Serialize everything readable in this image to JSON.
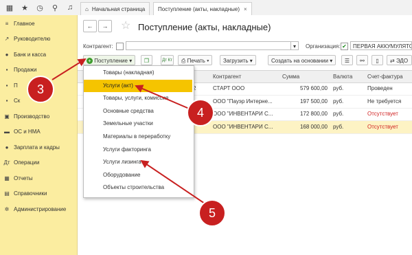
{
  "topbar": {
    "home_tab": "Начальная страница",
    "doc_tab": "Поступление (акты, накладные)",
    "tab_close": "×"
  },
  "sidebar": {
    "items": [
      {
        "label": "Главное",
        "icon": "menu-icon",
        "glyph": "≡"
      },
      {
        "label": "Руководителю",
        "icon": "chart-icon",
        "glyph": "↗"
      },
      {
        "label": "Банк и касса",
        "icon": "bank-icon",
        "glyph": "●"
      },
      {
        "label": "Продажи",
        "icon": "bag-icon",
        "glyph": "▪"
      },
      {
        "label": "П",
        "icon": "purchases-icon",
        "glyph": "▪"
      },
      {
        "label": "Ск",
        "icon": "warehouse-icon",
        "glyph": "▪"
      },
      {
        "label": "Производство",
        "icon": "production-icon",
        "glyph": "▣"
      },
      {
        "label": "ОС и НМА",
        "icon": "assets-icon",
        "glyph": "▬"
      },
      {
        "label": "Зарплата и кадры",
        "icon": "people-icon",
        "glyph": "●"
      },
      {
        "label": "Операции",
        "icon": "operations-icon",
        "glyph": "Дт"
      },
      {
        "label": "Отчеты",
        "icon": "reports-icon",
        "glyph": "▦"
      },
      {
        "label": "Справочники",
        "icon": "catalog-icon",
        "glyph": "▤"
      },
      {
        "label": "Администрирование",
        "icon": "gear-icon",
        "glyph": "✲"
      }
    ]
  },
  "header": {
    "title": "Поступление (акты, накладные)",
    "back": "←",
    "forward": "→",
    "star": "☆"
  },
  "filters": {
    "contractor_label": "Контрагент:",
    "contractor_value": "",
    "org_label": "Организация:",
    "org_checked": "✔",
    "org_value": "ПЕРВАЯ АККУМУЛЯТОРНАЯ",
    "dropdown_glyph": "▾"
  },
  "toolbar": {
    "receipt": "Поступление",
    "print": "Печать",
    "load": "Загрузить",
    "create_basis": "Создать на основании",
    "edo": "ЭДО",
    "dt_kt": "Дт Кт"
  },
  "table": {
    "columns": [
      "Контрагент",
      "Сумма",
      "Валюта",
      "Счет-фактура"
    ],
    "rows": [
      {
        "num_tail": "2",
        "contractor": "СТАРТ ООО",
        "sum": "579 600,00",
        "currency": "руб.",
        "invoice": "Проведен",
        "invoice_color": "#333333"
      },
      {
        "num_tail": "",
        "contractor": "ООО \"Пауэр Интерне...",
        "sum": "197 500,00",
        "currency": "руб.",
        "invoice": "Не требуется",
        "invoice_color": "#333333"
      },
      {
        "num_tail": "",
        "contractor": "ООО \"ИНВЕНТАРИ С...",
        "sum": "172 800,00",
        "currency": "руб.",
        "invoice": "Отсутствует",
        "invoice_color": "#d02020"
      },
      {
        "num_tail": "",
        "contractor": "ООО \"ИНВЕНТАРИ С...",
        "sum": "168 000,00",
        "currency": "руб.",
        "invoice": "Отсутствует",
        "invoice_color": "#d02020"
      }
    ]
  },
  "menu": {
    "items": [
      "Товары (накладная)",
      "Услуги (акт)",
      "Товары, услуги, комиссия",
      "Основные средства",
      "Земельные участки",
      "Материалы в переработку",
      "Услуги факторинга",
      "Услуги лизинга",
      "Оборудование",
      "Объекты строительства"
    ],
    "highlighted_index": 1
  },
  "callouts": [
    "3",
    "4",
    "5"
  ],
  "colors": {
    "sidebar": "#fbeda0",
    "highlight": "#f5c400",
    "callout": "#c82020",
    "selected_row": "#fdf3c4"
  }
}
